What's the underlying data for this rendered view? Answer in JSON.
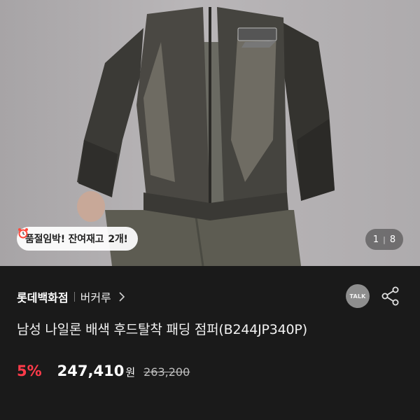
{
  "product_image": {
    "alt": "jacket-photo",
    "stock_badge": {
      "text": "품절임박! 잔여재고 ",
      "qty": "2개!"
    },
    "pager": {
      "current": "1",
      "separator": "|",
      "total": "8"
    }
  },
  "brand": {
    "store": "롯데백화점",
    "brand_name": "버커루"
  },
  "actions": {
    "talk_label": "TALK"
  },
  "product": {
    "title": "남성 나일론 배색 후드탈착 패딩 점퍼(B244JP340P)"
  },
  "price": {
    "discount": "5%",
    "sale_price": "247,410",
    "currency": "원",
    "original_price": "263,200"
  },
  "colors": {
    "discount_red": "#ff3b4a",
    "background": "#1a1a1a"
  }
}
